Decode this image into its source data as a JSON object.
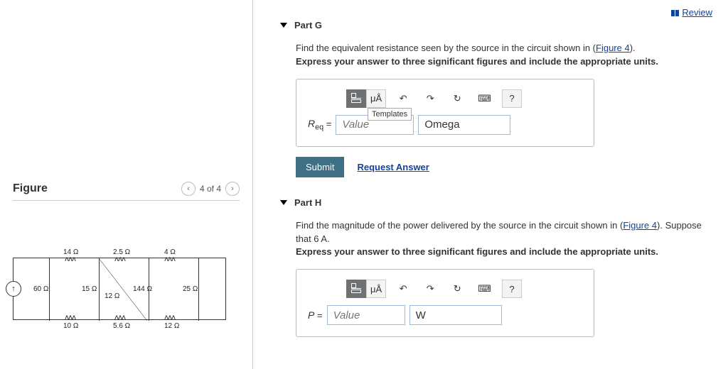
{
  "review": {
    "label": "Review"
  },
  "figure": {
    "title": "Figure",
    "pager": "4 of 4",
    "labels": {
      "r14": "14 Ω",
      "r25a": "2.5 Ω",
      "r4": "4 Ω",
      "r60": "60 Ω",
      "r15": "15 Ω",
      "r12a": "12 Ω",
      "r144": "144 Ω",
      "r25": "25 Ω",
      "r10": "10 Ω",
      "r56": "5.6 Ω",
      "r12": "12 Ω"
    }
  },
  "partG": {
    "title": "Part G",
    "q_before": "Find the equivalent resistance seen by the source in the circuit shown in (",
    "fig_link": "Figure 4",
    "q_after": ").",
    "instr": "Express your answer to three significant figures and include the appropriate units.",
    "var": "R",
    "sub": "eq",
    "eq": " = ",
    "value_ph": "Value",
    "unit_val": "Omega",
    "templates_tip": "Templates",
    "mu": "μÅ",
    "submit": "Submit",
    "request": "Request Answer",
    "help": "?"
  },
  "partH": {
    "title": "Part H",
    "q_before": "Find the magnitude of the power delivered by the source in the circuit shown in (",
    "fig_link": "Figure 4",
    "q_after": "). Suppose that 6 A.",
    "instr": "Express your answer to three significant figures and include the appropriate units.",
    "var": "P",
    "eq": " = ",
    "value_ph": "Value",
    "unit_val": "W",
    "mu": "μÅ",
    "help": "?"
  }
}
